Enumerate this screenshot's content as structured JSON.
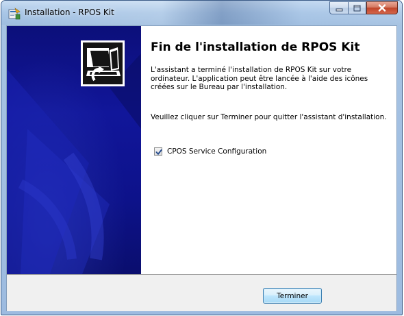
{
  "window": {
    "title": "Installation - RPOS Kit"
  },
  "content": {
    "heading": "Fin de l'installation de RPOS Kit",
    "paragraph1": "L'assistant a terminé l'installation de RPOS Kit sur votre ordinateur. L'application peut être lancée à l'aide des icônes créées sur le Bureau par l'installation.",
    "paragraph2": "Veuillez cliquer sur Terminer pour quitter l'assistant d'installation.",
    "checkbox": {
      "label": "CPOS Service Configuration",
      "checked": true
    }
  },
  "footer": {
    "finish_label": "Terminer"
  },
  "icons": {
    "title": "installer-icon",
    "logo": "computer-install-icon",
    "minimize": "minimize-icon",
    "maximize": "maximize-icon",
    "close": "close-icon"
  },
  "colors": {
    "side_panel": "#11169a",
    "close_button": "#c0452a",
    "button_border": "#3c7fb1"
  }
}
